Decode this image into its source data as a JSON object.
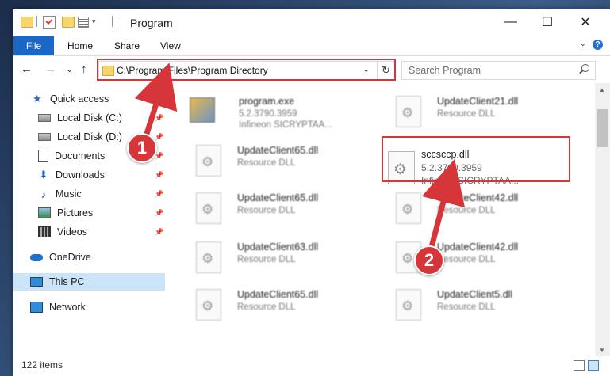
{
  "window": {
    "title": "Program"
  },
  "quick_access_toolbar": {
    "icons": [
      "folder-icon",
      "checkmark-icon",
      "folder-icon",
      "properties-icon",
      "chevron-down-icon"
    ]
  },
  "title_controls": {
    "minimize": "—",
    "maximize": "☐",
    "close": "✕"
  },
  "ribbon": {
    "file": "File",
    "tabs": [
      "Home",
      "Share",
      "View"
    ],
    "expand": "⌄",
    "help": "?"
  },
  "nav": {
    "back": "←",
    "forward": "→",
    "recent": "⌄",
    "up": "↑",
    "refresh": "↻",
    "dropdown": "⌄"
  },
  "address": {
    "path": "C:\\Program Files\\Program Directory"
  },
  "search": {
    "placeholder": "Search Program"
  },
  "sidebar": {
    "quick_access": "Quick access",
    "items": [
      {
        "label": "Local Disk (C:)",
        "icon": "drive-icon",
        "pinned": true
      },
      {
        "label": "Local Disk (D:)",
        "icon": "drive-icon",
        "pinned": true
      },
      {
        "label": "Documents",
        "icon": "documents-icon",
        "pinned": true
      },
      {
        "label": "Downloads",
        "icon": "downloads-icon",
        "pinned": true
      },
      {
        "label": "Music",
        "icon": "music-icon",
        "pinned": true
      },
      {
        "label": "Pictures",
        "icon": "pictures-icon",
        "pinned": true
      },
      {
        "label": "Videos",
        "icon": "videos-icon",
        "pinned": true
      }
    ],
    "onedrive": "OneDrive",
    "this_pc": "This PC",
    "network": "Network"
  },
  "files": [
    {
      "name": "program.exe",
      "sub1": "5.2.3790.3959",
      "sub2": "Infineon SICRYPTAA..."
    },
    {
      "name": "UpdateClient21.dll",
      "sub1": "Resource DLL"
    },
    {
      "name": "UpdateClient65.dll",
      "sub1": "Resource DLL"
    },
    {
      "name": "UpdateClient65.dll",
      "sub1": "Resource DLL"
    },
    {
      "name": "UpdateClient42.dll",
      "sub1": "Resource DLL"
    },
    {
      "name": "UpdateClient63.dll",
      "sub1": "Resource DLL"
    },
    {
      "name": "UpdateClient42.dll",
      "sub1": "Resource DLL"
    },
    {
      "name": "UpdateClient65.dll",
      "sub1": "Resource DLL"
    },
    {
      "name": "UpdateClient5.dll",
      "sub1": "Resource DLL"
    }
  ],
  "focus_file": {
    "name": "sccsccp.dll",
    "version": "5.2.3790.3959",
    "company": "Infineon SICRYPTAA..."
  },
  "status": {
    "items": "122 items"
  },
  "callouts": {
    "one": "1",
    "two": "2"
  },
  "colors": {
    "accent": "#1a66c9",
    "highlight": "#d6353a",
    "selection": "#cce4f7"
  }
}
